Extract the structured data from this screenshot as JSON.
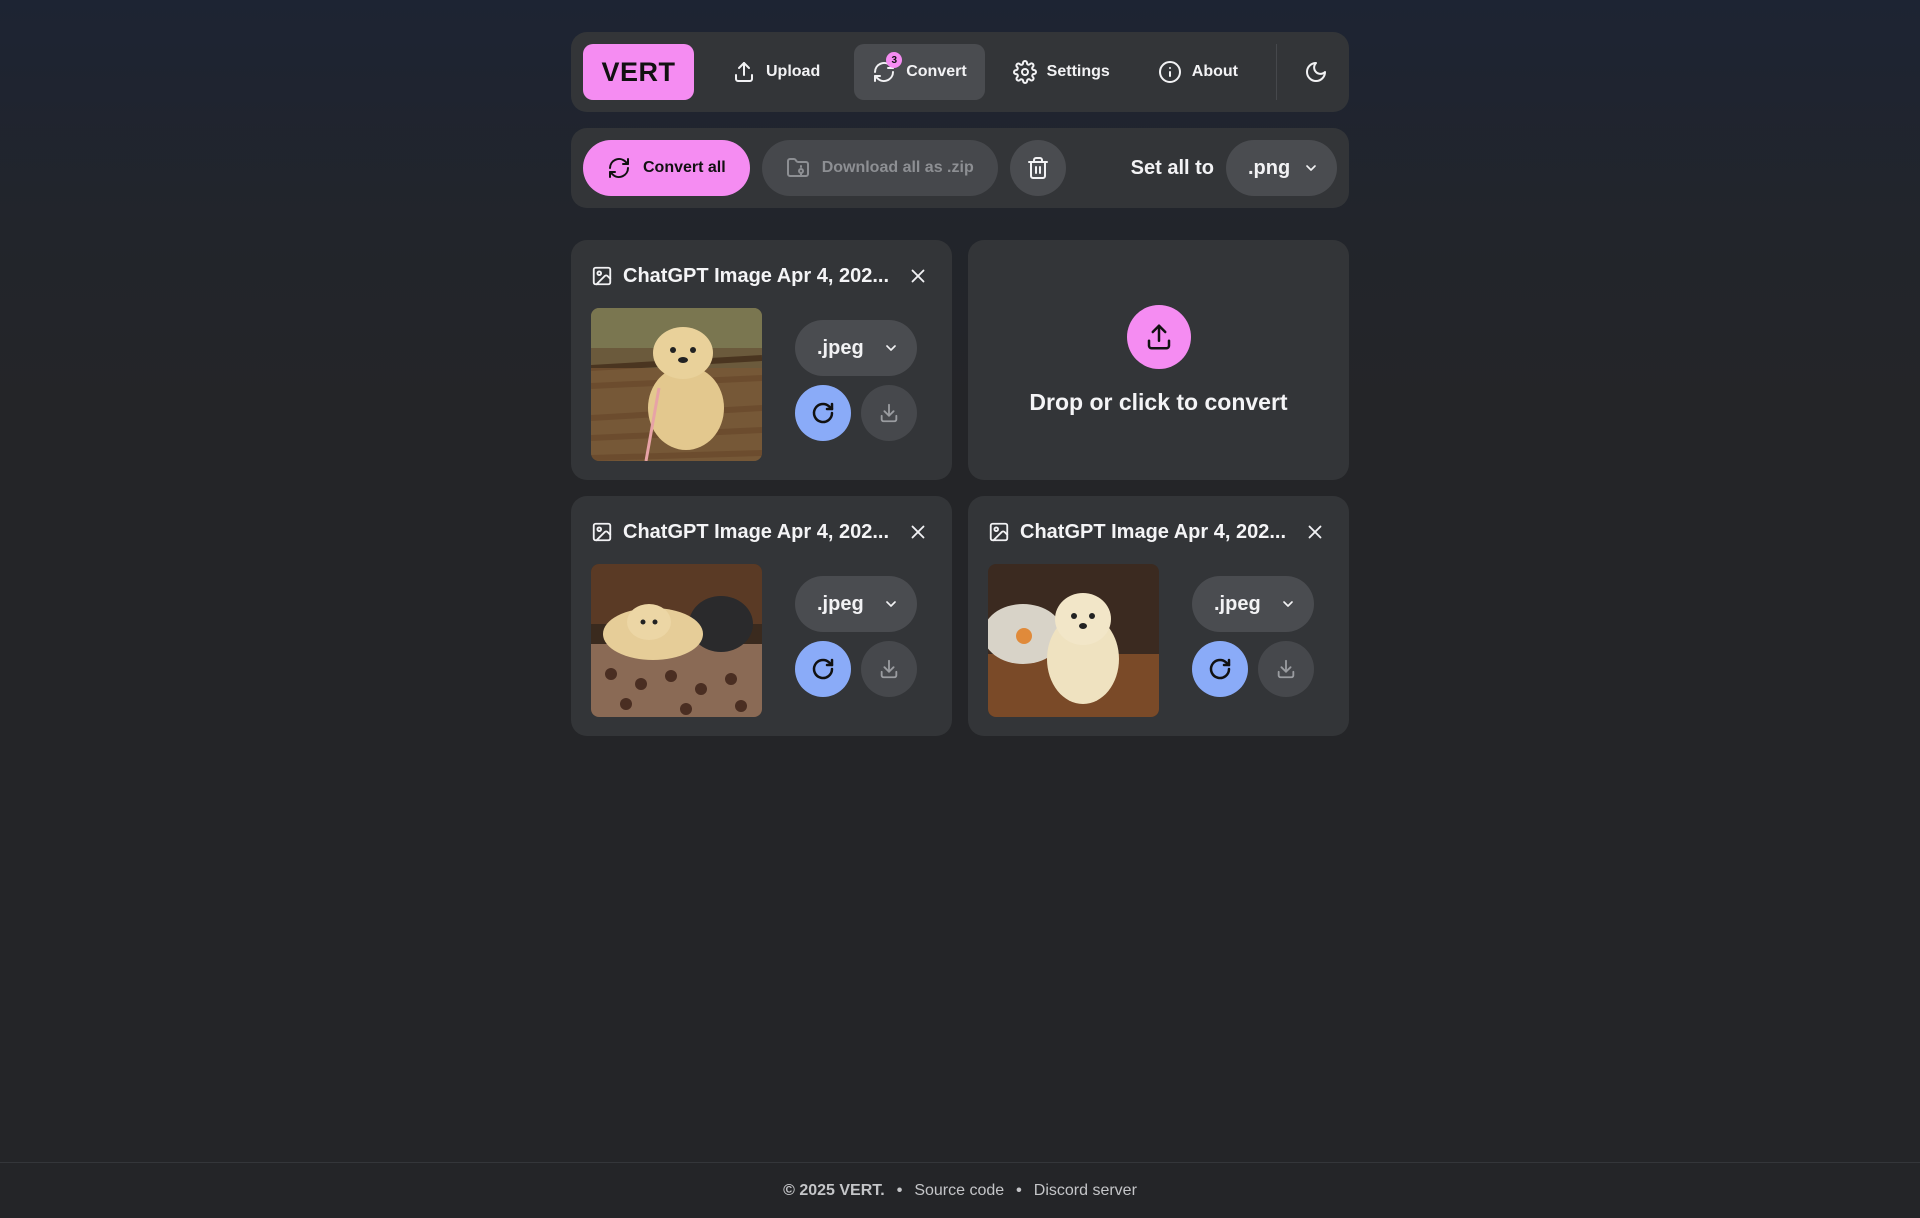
{
  "nav": {
    "logo": "VERT",
    "items": [
      {
        "label": "Upload",
        "icon": "upload-icon"
      },
      {
        "label": "Convert",
        "icon": "refresh-icon",
        "badge": "3",
        "active": true
      },
      {
        "label": "Settings",
        "icon": "gear-icon"
      },
      {
        "label": "About",
        "icon": "info-icon"
      }
    ],
    "theme_icon": "moon-icon"
  },
  "toolbar": {
    "convert_all": "Convert all",
    "download_zip": "Download all as .zip",
    "delete_icon": "trash-icon",
    "set_all_label": "Set all to",
    "set_all_value": ".png"
  },
  "files": [
    {
      "name": "ChatGPT Image Apr 4, 202...",
      "format": ".jpeg",
      "thumb": "dog-on-bench"
    },
    {
      "name": "ChatGPT Image Apr 4, 202...",
      "format": ".jpeg",
      "thumb": "dog-on-sofa-lying"
    },
    {
      "name": "ChatGPT Image Apr 4, 202...",
      "format": ".jpeg",
      "thumb": "dog-with-aloha-pillow"
    }
  ],
  "dropzone": {
    "label": "Drop or click to convert",
    "icon": "upload-icon"
  },
  "footer": {
    "copyright": "© 2025 VERT.",
    "links": [
      "Source code",
      "Discord server"
    ]
  },
  "colors": {
    "accent": "#f58cf2",
    "convert_blue": "#8aabf8",
    "panel": "#333538",
    "background": "#242528"
  }
}
